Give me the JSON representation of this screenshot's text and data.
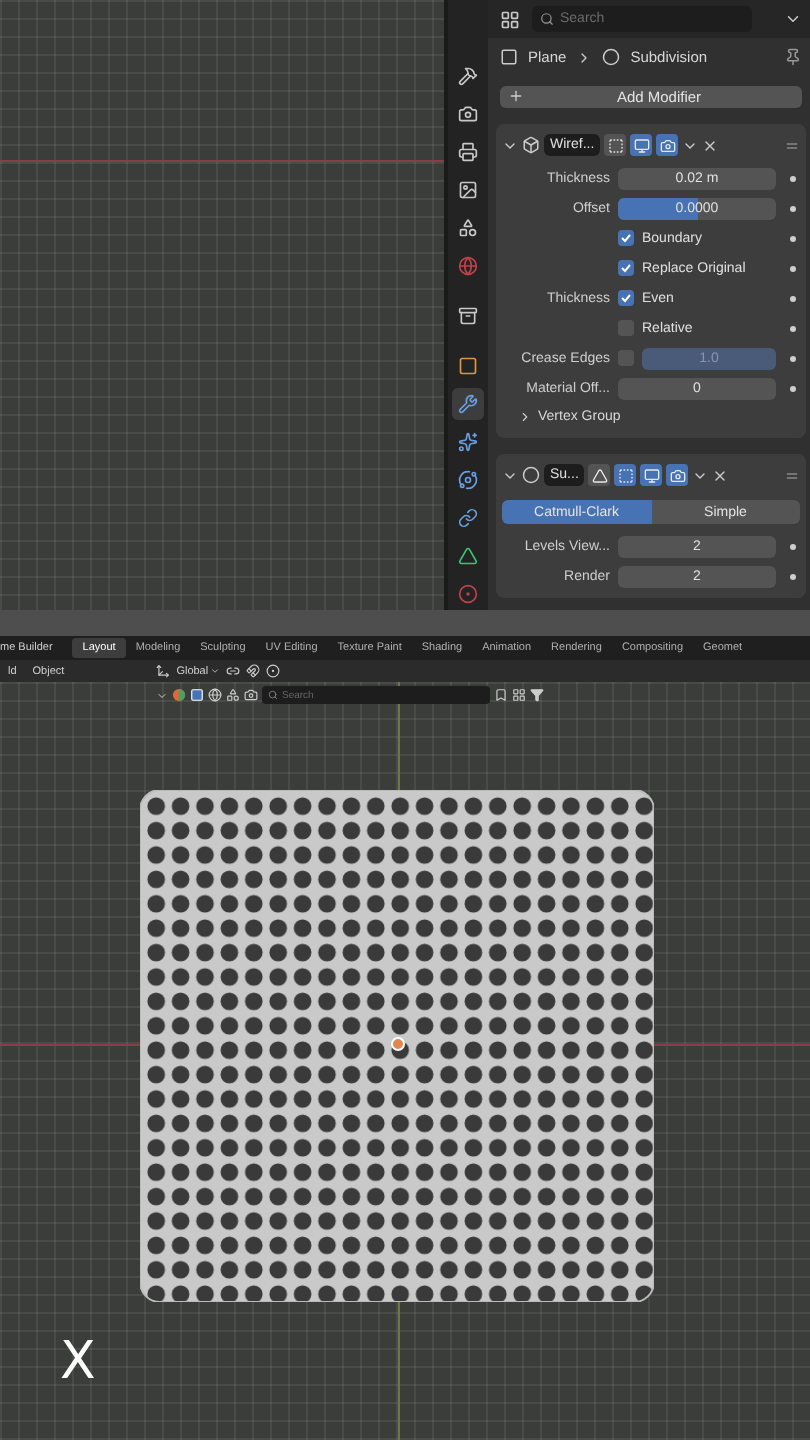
{
  "properties": {
    "search": {
      "placeholder": "Search"
    },
    "breadcrumb": [
      "Plane",
      "Subdivision"
    ],
    "tabs": [
      {
        "kind": "tool",
        "selected": false
      },
      {
        "kind": "render",
        "selected": false
      },
      {
        "kind": "output",
        "selected": false
      },
      {
        "kind": "view_layer",
        "selected": false
      },
      {
        "kind": "scene",
        "selected": false
      },
      {
        "kind": "world",
        "selected": false
      },
      {
        "kind": "collection",
        "selected": false
      },
      {
        "kind": "object",
        "selected": false
      },
      {
        "kind": "modifier",
        "selected": true
      },
      {
        "kind": "particles",
        "selected": false
      },
      {
        "kind": "physics",
        "selected": false
      },
      {
        "kind": "constraints",
        "selected": false
      },
      {
        "kind": "data",
        "selected": false
      },
      {
        "kind": "material",
        "selected": false
      }
    ],
    "add_modifier": "Add Modifier",
    "modifiers": [
      {
        "kind": "wireframe",
        "expanded": true,
        "name": "Wiref...",
        "toggles": [
          {
            "kind": "editmode",
            "on": false
          },
          {
            "kind": "viewport",
            "on": true
          },
          {
            "kind": "render",
            "on": true
          }
        ],
        "rows": [
          {
            "kind": "number",
            "label": "Thickness",
            "value": "0.02 m"
          },
          {
            "kind": "slider",
            "label": "Offset",
            "value": "0.0000",
            "level": 0.5
          },
          {
            "kind": "check",
            "label": "Boundary",
            "checked": true
          },
          {
            "kind": "check",
            "label": "Replace Original",
            "checked": true
          },
          {
            "kind": "check",
            "heading": "Thickness",
            "label": "Even",
            "checked": true
          },
          {
            "kind": "check",
            "label": "Relative",
            "checked": false
          },
          {
            "kind": "check_slider",
            "label": "Crease Edges",
            "checked": false,
            "value": "1.0",
            "disabled": true
          },
          {
            "kind": "number",
            "label": "Material Off...",
            "value": "0"
          },
          {
            "kind": "subpanel",
            "label": "Vertex Group",
            "expanded": false
          }
        ]
      },
      {
        "kind": "subdivision",
        "expanded": true,
        "name": "Su...",
        "toggles": [
          {
            "kind": "cage",
            "on": false
          },
          {
            "kind": "editmode",
            "on": true
          },
          {
            "kind": "viewport",
            "on": true
          },
          {
            "kind": "render",
            "on": true
          }
        ],
        "rows": [
          {
            "kind": "choice",
            "options": [
              {
                "label": "Catmull-Clark",
                "selected": true
              },
              {
                "label": "Simple",
                "selected": false
              }
            ]
          },
          {
            "kind": "number",
            "label": "Levels View...",
            "value": "2"
          },
          {
            "kind": "number",
            "label": "Render",
            "value": "2"
          }
        ]
      }
    ]
  },
  "topbar": {
    "app_menu": "me Builder",
    "workspaces": [
      {
        "label": "Layout",
        "selected": true
      },
      {
        "label": "Modeling",
        "selected": false
      },
      {
        "label": "Sculpting",
        "selected": false
      },
      {
        "label": "UV Editing",
        "selected": false
      },
      {
        "label": "Texture Paint",
        "selected": false
      },
      {
        "label": "Shading",
        "selected": false
      },
      {
        "label": "Animation",
        "selected": false
      },
      {
        "label": "Rendering",
        "selected": false
      },
      {
        "label": "Compositing",
        "selected": false
      },
      {
        "label": "Geomet",
        "selected": false
      }
    ]
  },
  "viewport_header": {
    "menus": [
      "ld",
      "Object"
    ],
    "orientation": "Global",
    "search": {
      "placeholder": "Search"
    }
  },
  "overlay_caption": "X"
}
